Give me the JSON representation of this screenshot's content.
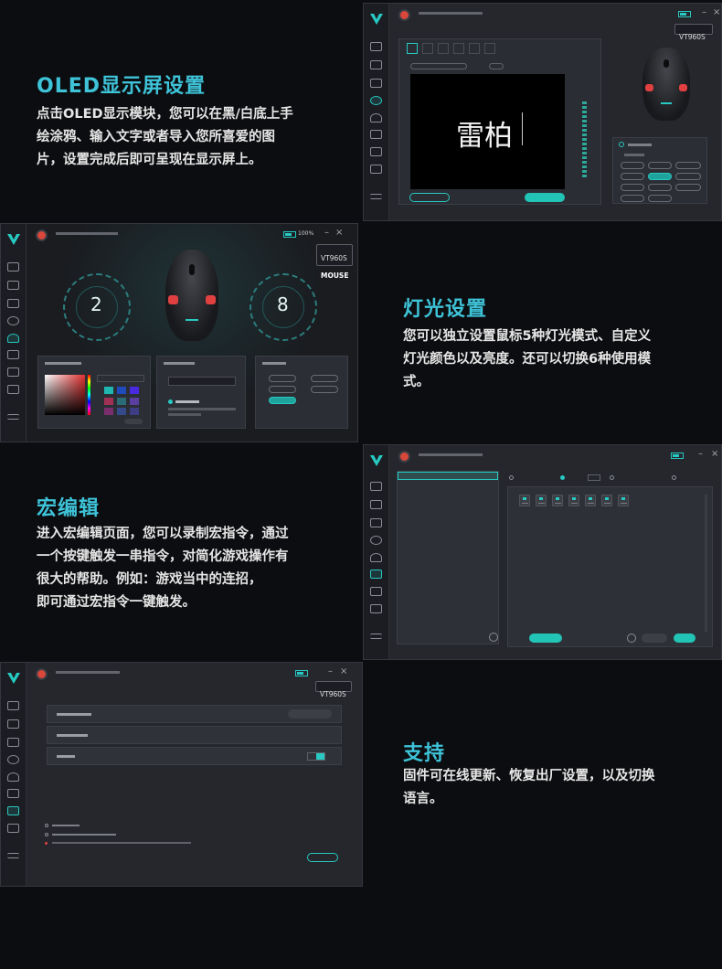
{
  "sections": {
    "oled": {
      "title": "OLED显示屏设置",
      "lines": [
        "点击OLED显示模块，您可以在黑/白底上手",
        "绘涂鸦、输入文字或者导入您所喜爱的图",
        "片，设置完成后即可呈现在显示屏上。"
      ]
    },
    "light": {
      "title": "灯光设置",
      "lines": [
        "您可以独立设置鼠标5种灯光模式、自定义",
        "灯光颜色以及亮度。还可以切换6种使用模",
        "式。"
      ]
    },
    "macro": {
      "title": "宏编辑",
      "lines": [
        "进入宏编辑页面，您可以录制宏指令，通过",
        "一个按键触发一串指令，对简化游戏操作有",
        "很大的帮助。例如：游戏当中的连招，",
        "即可通过宏指令一键触发。"
      ]
    },
    "support": {
      "title": "支持",
      "lines": [
        "固件可在线更新、恢复出厂设置，以及切换",
        "语言。"
      ]
    }
  },
  "app1": {
    "device": "VT960S",
    "canvas_text": "雷柏"
  },
  "app2": {
    "device": "VT960S",
    "device_sub": "MOUSE",
    "battery": "100%",
    "gauge_left": "2",
    "gauge_right": "8"
  },
  "app4": {
    "device": "VT960S"
  },
  "colors": {
    "accent": "#27c9c2",
    "title": "#3ec3d8",
    "bg": "#0c0d10",
    "panel": "#25272d"
  }
}
